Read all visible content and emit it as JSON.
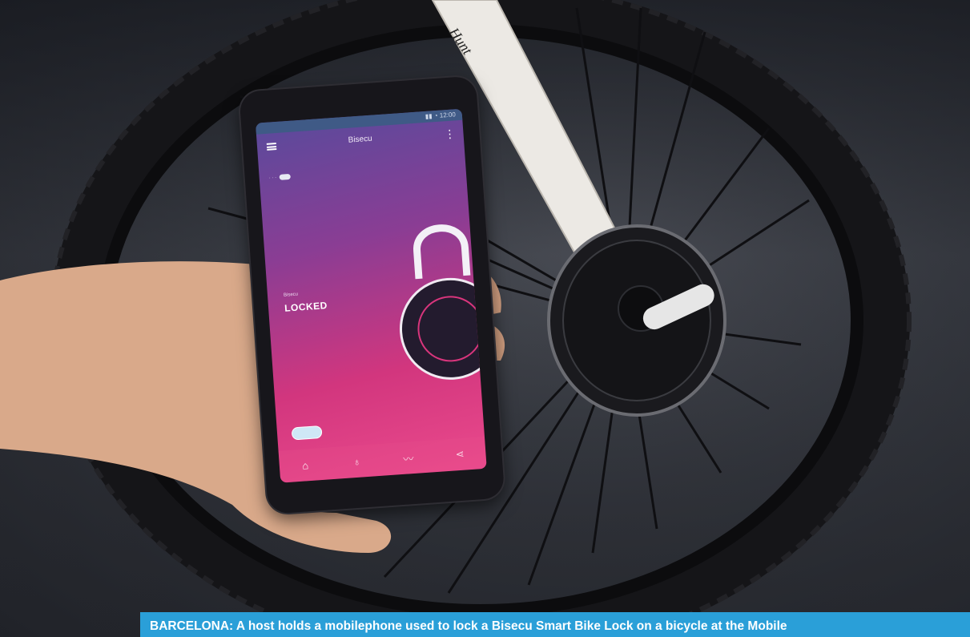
{
  "photo": {
    "subject": "Hand holding a smartphone next to a smart lock on a bicycle wheel hub"
  },
  "phone_app": {
    "app_title": "Bisecu",
    "status_label": "Bisecu",
    "lock_status": "LOCKED",
    "menu_icon": "hamburger-icon",
    "more_icon": "more-vertical-icon",
    "nav_icons": [
      "home-icon",
      "bike-icon",
      "chart-icon",
      "share-icon"
    ]
  },
  "caption": {
    "text": "BARCELONA: A host holds a mobilephone used to lock a Bisecu Smart Bike Lock on a bicycle at the Mobile"
  },
  "colors": {
    "caption_bg": "#2a9fd8",
    "screen_gradient_top": "#5a4a9c",
    "screen_gradient_bottom": "#ea4a8c"
  }
}
